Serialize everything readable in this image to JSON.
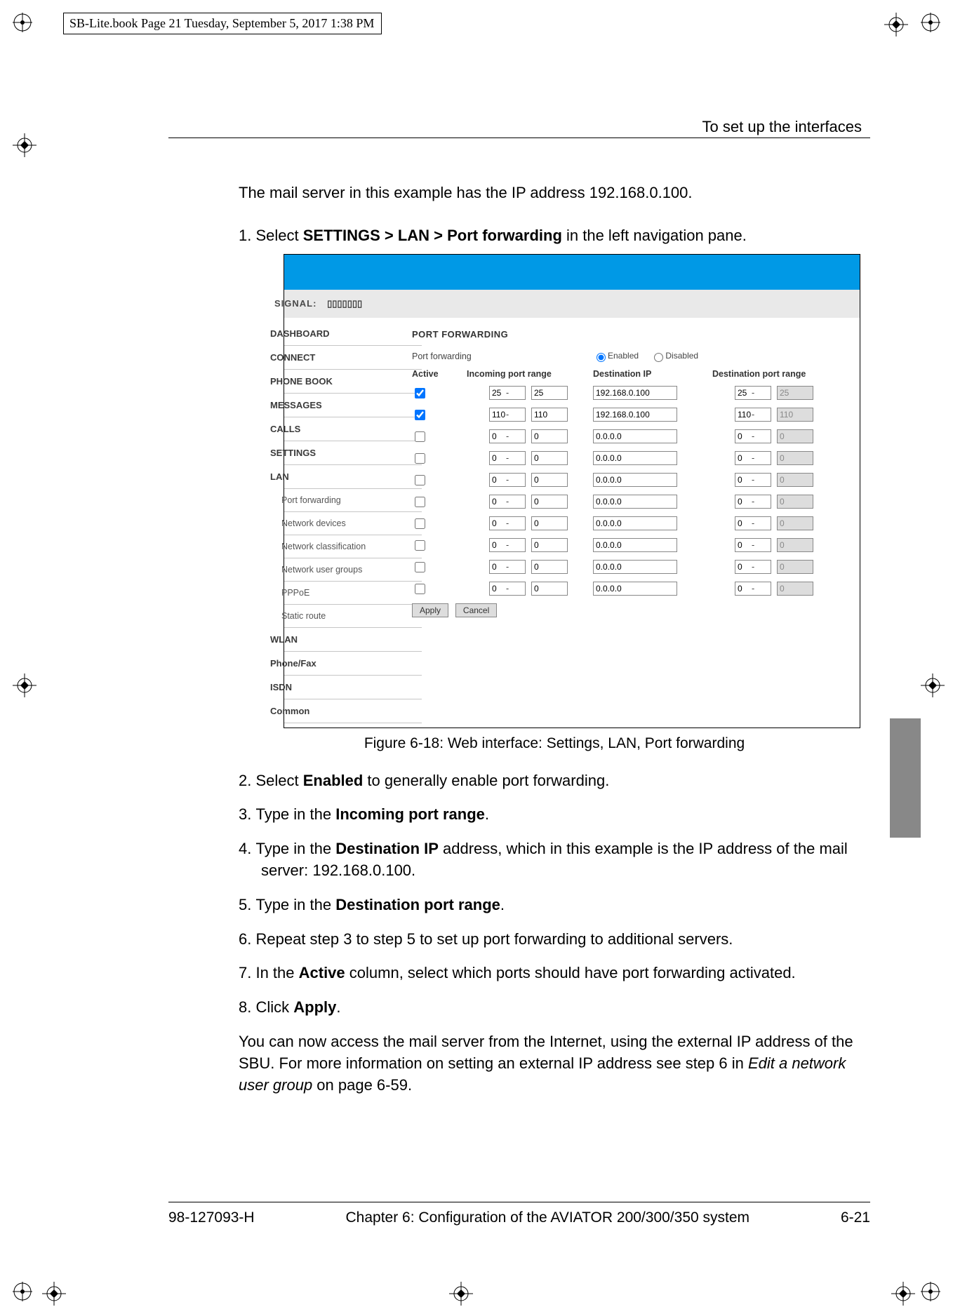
{
  "crop_meta": "SB-Lite.book  Page 21  Tuesday, September 5, 2017  1:38 PM",
  "running_head": "To set up the interfaces",
  "intro": "The mail server in this example has the IP address 192.168.0.100.",
  "step1_pre": "Select ",
  "step1_bold": "SETTINGS > LAN > Port forwarding",
  "step1_post": " in the left navigation pane.",
  "figure_caption": "Figure 6-18: Web interface: Settings, LAN, Port forwarding",
  "step2_pre": "Select ",
  "step2_bold": "Enabled",
  "step2_post": " to generally enable port forwarding.",
  "step3_pre": "Type in the ",
  "step3_bold": "Incoming port range",
  "step3_post": ".",
  "step4_pre": "Type in the ",
  "step4_bold": "Destination IP",
  "step4_post": " address, which in this example is the IP address of the mail server: 192.168.0.100.",
  "step5_pre": "Type in the ",
  "step5_bold": "Destination port range",
  "step5_post": ".",
  "step6": "Repeat step 3 to step 5 to set up port forwarding to additional servers.",
  "step7_pre": "In the ",
  "step7_bold": "Active",
  "step7_post": " column, select which ports should have port forwarding activated.",
  "step8_pre": "Click ",
  "step8_bold": "Apply",
  "step8_post": ".",
  "outro_a": "You can now access the mail server from the Internet, using the external IP address of the SBU. For more information on setting an external IP address see step 6 in ",
  "outro_em": "Edit a network user group",
  "outro_b": " on page 6-59.",
  "footer": {
    "docnum": "98-127093-H",
    "chapter": "Chapter 6:  Configuration of the AVIATOR 200/300/350 system",
    "pagenum": "6-21"
  },
  "ui": {
    "signal_label": "SIGNAL:",
    "signal_bars": "▯▯▯▯▯▯▯",
    "nav": [
      "DASHBOARD",
      "CONNECT",
      "PHONE BOOK",
      "MESSAGES",
      "CALLS",
      "SETTINGS"
    ],
    "nav_sub_header": "LAN",
    "nav_subs": [
      "Port forwarding",
      "Network devices",
      "Network classification",
      "Network user groups",
      "PPPoE",
      "Static route"
    ],
    "nav_after": [
      "WLAN",
      "Phone/Fax",
      "ISDN",
      "Common"
    ],
    "panel_title": "PORT FORWARDING",
    "pf_label": "Port forwarding",
    "enabled": "Enabled",
    "disabled": "Disabled",
    "col_active": "Active",
    "col_in": "Incoming port range",
    "col_dest": "Destination IP",
    "col_out": "Destination port range",
    "rows": [
      {
        "active": true,
        "in1": "25",
        "in2": "25",
        "dest": "192.168.0.100",
        "out1": "25",
        "out2": "25"
      },
      {
        "active": true,
        "in1": "110",
        "in2": "110",
        "dest": "192.168.0.100",
        "out1": "110",
        "out2": "110"
      },
      {
        "active": false,
        "in1": "0",
        "in2": "0",
        "dest": "0.0.0.0",
        "out1": "0",
        "out2": "0"
      },
      {
        "active": false,
        "in1": "0",
        "in2": "0",
        "dest": "0.0.0.0",
        "out1": "0",
        "out2": "0"
      },
      {
        "active": false,
        "in1": "0",
        "in2": "0",
        "dest": "0.0.0.0",
        "out1": "0",
        "out2": "0"
      },
      {
        "active": false,
        "in1": "0",
        "in2": "0",
        "dest": "0.0.0.0",
        "out1": "0",
        "out2": "0"
      },
      {
        "active": false,
        "in1": "0",
        "in2": "0",
        "dest": "0.0.0.0",
        "out1": "0",
        "out2": "0"
      },
      {
        "active": false,
        "in1": "0",
        "in2": "0",
        "dest": "0.0.0.0",
        "out1": "0",
        "out2": "0"
      },
      {
        "active": false,
        "in1": "0",
        "in2": "0",
        "dest": "0.0.0.0",
        "out1": "0",
        "out2": "0"
      },
      {
        "active": false,
        "in1": "0",
        "in2": "0",
        "dest": "0.0.0.0",
        "out1": "0",
        "out2": "0"
      }
    ],
    "apply": "Apply",
    "cancel": "Cancel"
  }
}
